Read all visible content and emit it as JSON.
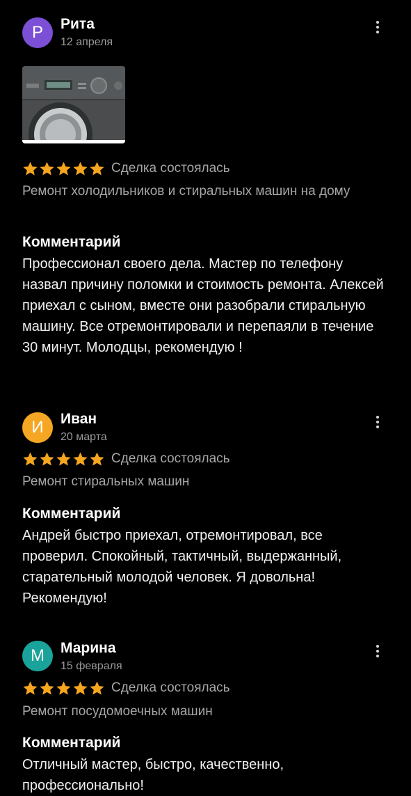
{
  "colors": {
    "background": "#000000",
    "star": "#f5a61e",
    "muted_text": "#a6a6a6"
  },
  "reviews": [
    {
      "avatar_letter": "Р",
      "avatar_color": "#7b4fd6",
      "name": "Рита",
      "date": "12 апреля",
      "has_photo": true,
      "photo_icon": "washing-machine-photo",
      "rating": 5,
      "status": "Сделка состоялась",
      "service": "Ремонт холодильников и стиральных машин на дому",
      "comment_heading": "Комментарий",
      "comment": "Профессионал своего дела. Мастер по телефону назвал причину поломки и стоимость ремонта. Алексей приехал с сыном, вместе они разобрали стиральную машину. Все отремонтировали и перепаяли в течение 30 минут. Молодцы, рекомендую !"
    },
    {
      "avatar_letter": "И",
      "avatar_color": "#f5a623",
      "name": "Иван",
      "date": "20 марта",
      "has_photo": false,
      "rating": 5,
      "status": "Сделка состоялась",
      "service": "Ремонт стиральных машин",
      "comment_heading": "Комментарий",
      "comment": "Андрей быстро приехал, отремонтировал, все проверил. Спокойный, тактичный, выдержанный, старательный молодой человек. Я довольна! Рекомендую!"
    },
    {
      "avatar_letter": "М",
      "avatar_color": "#1aa39a",
      "name": "Марина",
      "date": "15 февраля",
      "has_photo": false,
      "rating": 5,
      "status": "Сделка состоялась",
      "service": "Ремонт посудомоечных машин",
      "comment_heading": "Комментарий",
      "comment": "Отличный мастер, быстро, качественно, профессионально!"
    }
  ]
}
